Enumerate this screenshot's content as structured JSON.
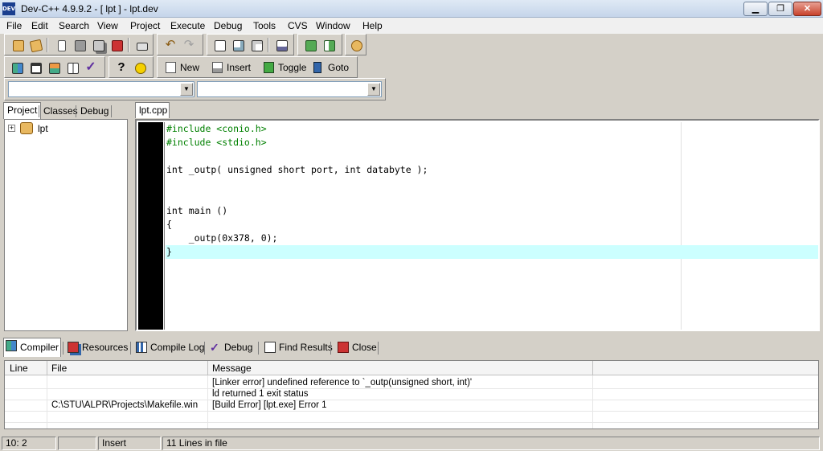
{
  "window": {
    "title": "Dev-C++ 4.9.9.2  - [ lpt ] - lpt.dev",
    "app_icon_text": "DEV",
    "min_glyph": "▁",
    "max_glyph": "❐",
    "close_glyph": "✕"
  },
  "menu": [
    "File",
    "Edit",
    "Search",
    "View",
    "Project",
    "Execute",
    "Debug",
    "Tools",
    "CVS",
    "Window",
    "Help"
  ],
  "toolbar2": {
    "new_label": "New",
    "insert_label": "Insert",
    "toggle_label": "Toggle",
    "goto_label": "Goto"
  },
  "left_panel": {
    "tabs": [
      "Project",
      "Classes",
      "Debug"
    ],
    "tree_root": "lpt",
    "expander": "+"
  },
  "editor": {
    "tab": "lpt.cpp",
    "lines": [
      "#include <conio.h>",
      "#include <stdio.h>",
      "",
      "int _outp( unsigned short port, int databyte );",
      "",
      "",
      "int main ()",
      "{",
      "    _outp(0x378, 0);",
      "}"
    ]
  },
  "bottom_tabs": [
    "Compiler",
    "Resources",
    "Compile Log",
    "Debug",
    "Find Results",
    "Close"
  ],
  "results": {
    "columns": [
      "Line",
      "File",
      "Message"
    ],
    "rows": [
      {
        "line": "",
        "file": "",
        "message": "[Linker error] undefined reference to `_outp(unsigned short, int)'"
      },
      {
        "line": "",
        "file": "",
        "message": "ld returned 1 exit status"
      },
      {
        "line": "",
        "file": "C:\\STU\\ALPR\\Projects\\Makefile.win",
        "message": "[Build Error]  [lpt.exe] Error 1"
      }
    ]
  },
  "status": {
    "position": "10: 2",
    "modified": "",
    "mode": "Insert",
    "info": "11 Lines in file"
  }
}
